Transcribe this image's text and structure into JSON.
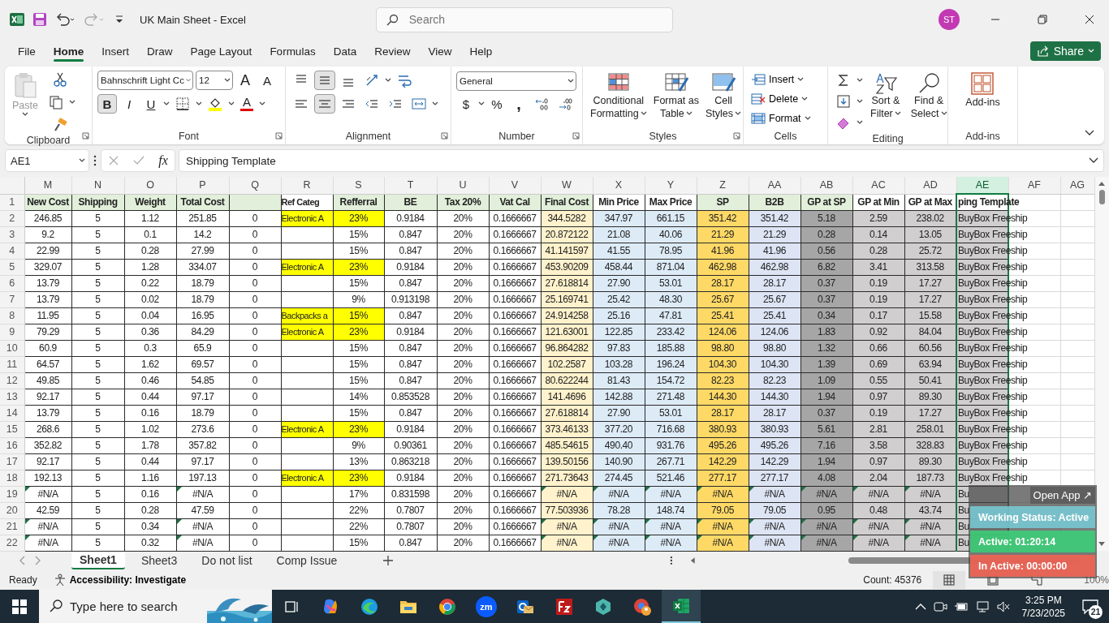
{
  "title_bar": {
    "title": "UK Main Sheet  -  Excel",
    "search_placeholder": "Search",
    "avatar": "ST"
  },
  "menu_tabs": [
    {
      "label": "File",
      "selected": false
    },
    {
      "label": "Home",
      "selected": true
    },
    {
      "label": "Insert",
      "selected": false
    },
    {
      "label": "Draw",
      "selected": false
    },
    {
      "label": "Page Layout",
      "selected": false
    },
    {
      "label": "Formulas",
      "selected": false
    },
    {
      "label": "Data",
      "selected": false
    },
    {
      "label": "Review",
      "selected": false
    },
    {
      "label": "View",
      "selected": false
    },
    {
      "label": "Help",
      "selected": false
    }
  ],
  "share_button": "Share",
  "ribbon": {
    "groups": [
      {
        "kind": "clipboard",
        "label": "Clipboard",
        "paste": "Paste"
      },
      {
        "kind": "font",
        "label": "Font",
        "font_name": "Bahnschrift Light Cc",
        "font_size": "12",
        "grow": "A",
        "shrink": "A",
        "font_color": "A",
        "styles": [
          {
            "kind": "bold",
            "label": "B",
            "on": true
          },
          {
            "kind": "italic",
            "label": "I",
            "on": false
          },
          {
            "kind": "underline",
            "label": "U",
            "on": false
          }
        ]
      },
      {
        "kind": "alignment",
        "label": "Alignment",
        "vertical": [
          {
            "kind": "top",
            "on": false
          },
          {
            "kind": "middle",
            "on": true
          },
          {
            "kind": "bottom",
            "on": false
          }
        ],
        "horizontal": [
          {
            "kind": "left",
            "on": false
          },
          {
            "kind": "center",
            "on": true
          },
          {
            "kind": "right",
            "on": false
          }
        ]
      },
      {
        "kind": "number",
        "label": "Number",
        "format": "General",
        "currency": "$",
        "percent": "%",
        "comma": ","
      },
      {
        "kind": "styles",
        "label": "Styles",
        "buttons": [
          {
            "line1": "Conditional",
            "line2": "Formatting"
          },
          {
            "line1": "Format as",
            "line2": "Table"
          },
          {
            "line1": "Cell",
            "line2": "Styles"
          }
        ]
      },
      {
        "kind": "cells",
        "label": "Cells",
        "buttons": [
          "Insert",
          "Delete",
          "Format"
        ]
      },
      {
        "kind": "editing",
        "label": "Editing",
        "buttons": [
          {
            "line1": "Sort &",
            "line2": "Filter"
          },
          {
            "line1": "Find &",
            "line2": "Select"
          }
        ]
      },
      {
        "kind": "addins",
        "label": "Add-ins",
        "button": "Add-ins"
      }
    ]
  },
  "formula_bar": {
    "name_box": "AE1",
    "fx": "fx",
    "formula": "Shipping Template"
  },
  "columns": [
    {
      "label": "M",
      "color": "#ffffff",
      "header_shaded": true,
      "error_check": true,
      "selected": false
    },
    {
      "label": "N",
      "color": "#ffffff",
      "header_shaded": true,
      "error_check": false,
      "selected": false
    },
    {
      "label": "O",
      "color": "#ffffff",
      "header_shaded": true,
      "error_check": false,
      "selected": false
    },
    {
      "label": "P",
      "color": "#ffffff",
      "header_shaded": true,
      "error_check": true,
      "selected": false
    },
    {
      "label": "Q",
      "color": "#ffffff",
      "header_shaded": true,
      "error_check": false,
      "selected": false
    },
    {
      "label": "R",
      "color": "#ffffff",
      "header_shaded": false,
      "error_check": false,
      "selected": false
    },
    {
      "label": "S",
      "color": "#ffffff",
      "header_shaded": true,
      "error_check": false,
      "selected": false
    },
    {
      "label": "T",
      "color": "#ffffff",
      "header_shaded": true,
      "error_check": false,
      "selected": false
    },
    {
      "label": "U",
      "color": "#ffffff",
      "header_shaded": true,
      "error_check": false,
      "selected": false
    },
    {
      "label": "V",
      "color": "#ffffff",
      "header_shaded": true,
      "error_check": false,
      "selected": false
    },
    {
      "label": "W",
      "color": "#fff2cc",
      "header_shaded": true,
      "error_check": true,
      "selected": false
    },
    {
      "label": "X",
      "color": "#ddebf7",
      "header_shaded": false,
      "error_check": true,
      "selected": false
    },
    {
      "label": "Y",
      "color": "#ddebf7",
      "header_shaded": false,
      "error_check": true,
      "selected": false
    },
    {
      "label": "Z",
      "color": "#ffd966",
      "header_shaded": true,
      "error_check": true,
      "selected": false
    },
    {
      "label": "AA",
      "color": "#dde4f4",
      "header_shaded": true,
      "error_check": true,
      "selected": false
    },
    {
      "label": "AB",
      "color": "#a6a6a6",
      "header_shaded": true,
      "error_check": true,
      "selected": false
    },
    {
      "label": "AC",
      "color": "#d0cece",
      "header_shaded": false,
      "error_check": true,
      "selected": false
    },
    {
      "label": "AD",
      "color": "#d0cece",
      "header_shaded": false,
      "error_check": true,
      "selected": false
    },
    {
      "label": "AE",
      "color": "#d0cece",
      "header_shaded": false,
      "error_check": false,
      "selected": true
    },
    {
      "label": "AF",
      "color": "#ffffff",
      "header_shaded": false,
      "error_check": false,
      "selected": false
    },
    {
      "label": "AG",
      "color": "#ffffff",
      "header_shaded": false,
      "error_check": false,
      "selected": false
    }
  ],
  "header_row": {
    "number": "1",
    "cells": [
      "New Cost",
      "Shipping",
      "Weight",
      "Total Cost",
      "",
      "Ref Categ",
      "Refferral",
      "BE",
      "Tax 20%",
      "Vat Cal",
      "Final Cost",
      "Min Price",
      "Max Price",
      "SP",
      "B2B",
      "GP at SP",
      "GP at Min",
      "GP at Max",
      "ping Template",
      "",
      ""
    ]
  },
  "rows": [
    {
      "number": "2",
      "highlight": true,
      "flagged": false,
      "cells": [
        "246.85",
        "5",
        "1.12",
        "251.85",
        "0",
        "Electronic A",
        "23%",
        "0.9184",
        "20%",
        "0.1666667",
        "344.5282",
        "347.97",
        "661.15",
        "351.42",
        "351.42",
        "5.18",
        "2.59",
        "238.02",
        "BuyBox Freeship",
        "",
        ""
      ]
    },
    {
      "number": "3",
      "highlight": false,
      "flagged": false,
      "cells": [
        "9.2",
        "5",
        "0.1",
        "14.2",
        "0",
        "",
        "15%",
        "0.847",
        "20%",
        "0.1666667",
        "20.872122",
        "21.08",
        "40.06",
        "21.29",
        "21.29",
        "0.28",
        "0.14",
        "13.05",
        "BuyBox Freeship",
        "",
        ""
      ]
    },
    {
      "number": "4",
      "highlight": false,
      "flagged": false,
      "cells": [
        "22.99",
        "5",
        "0.28",
        "27.99",
        "0",
        "",
        "15%",
        "0.847",
        "20%",
        "0.1666667",
        "41.141597",
        "41.55",
        "78.95",
        "41.96",
        "41.96",
        "0.56",
        "0.28",
        "25.72",
        "BuyBox Freeship",
        "",
        ""
      ]
    },
    {
      "number": "5",
      "highlight": true,
      "flagged": false,
      "cells": [
        "329.07",
        "5",
        "1.28",
        "334.07",
        "0",
        "Electronic A",
        "23%",
        "0.9184",
        "20%",
        "0.1666667",
        "453.90209",
        "458.44",
        "871.04",
        "462.98",
        "462.98",
        "6.82",
        "3.41",
        "313.58",
        "BuyBox Freeship",
        "",
        ""
      ]
    },
    {
      "number": "6",
      "highlight": false,
      "flagged": false,
      "cells": [
        "13.79",
        "5",
        "0.22",
        "18.79",
        "0",
        "",
        "15%",
        "0.847",
        "20%",
        "0.1666667",
        "27.618814",
        "27.90",
        "53.01",
        "28.17",
        "28.17",
        "0.37",
        "0.19",
        "17.27",
        "BuyBox Freeship",
        "",
        ""
      ]
    },
    {
      "number": "7",
      "highlight": false,
      "flagged": false,
      "cells": [
        "13.79",
        "5",
        "0.02",
        "18.79",
        "0",
        "",
        "9%",
        "0.913198",
        "20%",
        "0.1666667",
        "25.169741",
        "25.42",
        "48.30",
        "25.67",
        "25.67",
        "0.37",
        "0.19",
        "17.27",
        "BuyBox Freeship",
        "",
        ""
      ]
    },
    {
      "number": "8",
      "highlight": true,
      "flagged": false,
      "cells": [
        "11.95",
        "5",
        "0.04",
        "16.95",
        "0",
        "Backpacks a",
        "15%",
        "0.847",
        "20%",
        "0.1666667",
        "24.914258",
        "25.16",
        "47.81",
        "25.41",
        "25.41",
        "0.34",
        "0.17",
        "15.58",
        "BuyBox Freeship",
        "",
        ""
      ]
    },
    {
      "number": "9",
      "highlight": true,
      "flagged": false,
      "cells": [
        "79.29",
        "5",
        "0.36",
        "84.29",
        "0",
        "Electronic A",
        "23%",
        "0.9184",
        "20%",
        "0.1666667",
        "121.63001",
        "122.85",
        "233.42",
        "124.06",
        "124.06",
        "1.83",
        "0.92",
        "84.04",
        "BuyBox Freeship",
        "",
        ""
      ]
    },
    {
      "number": "10",
      "highlight": false,
      "flagged": false,
      "cells": [
        "60.9",
        "5",
        "0.3",
        "65.9",
        "0",
        "",
        "15%",
        "0.847",
        "20%",
        "0.1666667",
        "96.864282",
        "97.83",
        "185.88",
        "98.80",
        "98.80",
        "1.32",
        "0.66",
        "60.56",
        "BuyBox Freeship",
        "",
        ""
      ]
    },
    {
      "number": "11",
      "highlight": false,
      "flagged": false,
      "cells": [
        "64.57",
        "5",
        "1.62",
        "69.57",
        "0",
        "",
        "15%",
        "0.847",
        "20%",
        "0.1666667",
        "102.2587",
        "103.28",
        "196.24",
        "104.30",
        "104.30",
        "1.39",
        "0.69",
        "63.94",
        "BuyBox Freeship",
        "",
        ""
      ]
    },
    {
      "number": "12",
      "highlight": false,
      "flagged": false,
      "cells": [
        "49.85",
        "5",
        "0.46",
        "54.85",
        "0",
        "",
        "15%",
        "0.847",
        "20%",
        "0.1666667",
        "80.622244",
        "81.43",
        "154.72",
        "82.23",
        "82.23",
        "1.09",
        "0.55",
        "50.41",
        "BuyBox Freeship",
        "",
        ""
      ]
    },
    {
      "number": "13",
      "highlight": false,
      "flagged": false,
      "cells": [
        "92.17",
        "5",
        "0.44",
        "97.17",
        "0",
        "",
        "14%",
        "0.853528",
        "20%",
        "0.1666667",
        "141.4696",
        "142.88",
        "271.48",
        "144.30",
        "144.30",
        "1.94",
        "0.97",
        "89.30",
        "BuyBox Freeship",
        "",
        ""
      ]
    },
    {
      "number": "14",
      "highlight": false,
      "flagged": false,
      "cells": [
        "13.79",
        "5",
        "0.16",
        "18.79",
        "0",
        "",
        "15%",
        "0.847",
        "20%",
        "0.1666667",
        "27.618814",
        "27.90",
        "53.01",
        "28.17",
        "28.17",
        "0.37",
        "0.19",
        "17.27",
        "BuyBox Freeship",
        "",
        ""
      ]
    },
    {
      "number": "15",
      "highlight": true,
      "flagged": false,
      "cells": [
        "268.6",
        "5",
        "1.02",
        "273.6",
        "0",
        "Electronic A",
        "23%",
        "0.9184",
        "20%",
        "0.1666667",
        "373.46133",
        "377.20",
        "716.68",
        "380.93",
        "380.93",
        "5.61",
        "2.81",
        "258.01",
        "BuyBox Freeship",
        "",
        ""
      ]
    },
    {
      "number": "16",
      "highlight": false,
      "flagged": false,
      "cells": [
        "352.82",
        "5",
        "1.78",
        "357.82",
        "0",
        "",
        "9%",
        "0.90361",
        "20%",
        "0.1666667",
        "485.54615",
        "490.40",
        "931.76",
        "495.26",
        "495.26",
        "7.16",
        "3.58",
        "328.83",
        "BuyBox Freeship",
        "",
        ""
      ]
    },
    {
      "number": "17",
      "highlight": false,
      "flagged": false,
      "cells": [
        "92.17",
        "5",
        "0.44",
        "97.17",
        "0",
        "",
        "13%",
        "0.863218",
        "20%",
        "0.1666667",
        "139.50156",
        "140.90",
        "267.71",
        "142.29",
        "142.29",
        "1.94",
        "0.97",
        "89.30",
        "BuyBox Freeship",
        "",
        ""
      ]
    },
    {
      "number": "18",
      "highlight": true,
      "flagged": false,
      "cells": [
        "192.13",
        "5",
        "1.16",
        "197.13",
        "0",
        "Electronic A",
        "23%",
        "0.9184",
        "20%",
        "0.1666667",
        "271.73643",
        "274.45",
        "521.46",
        "277.17",
        "277.17",
        "4.08",
        "2.04",
        "187.73",
        "BuyBox Freeship",
        "",
        ""
      ]
    },
    {
      "number": "19",
      "highlight": false,
      "flagged": true,
      "cells": [
        "#N/A",
        "5",
        "0.16",
        "#N/A",
        "0",
        "",
        "17%",
        "0.831598",
        "20%",
        "0.1666667",
        "#N/A",
        "#N/A",
        "#N/A",
        "#N/A",
        "#N/A",
        "#N/A",
        "#N/A",
        "#N/A",
        "Bu",
        "",
        ""
      ]
    },
    {
      "number": "20",
      "highlight": false,
      "flagged": false,
      "cells": [
        "42.59",
        "5",
        "0.28",
        "47.59",
        "0",
        "",
        "22%",
        "0.7807",
        "20%",
        "0.1666667",
        "77.503936",
        "78.28",
        "148.74",
        "79.05",
        "79.05",
        "0.95",
        "0.48",
        "43.74",
        "Bu",
        "",
        ""
      ]
    },
    {
      "number": "21",
      "highlight": false,
      "flagged": true,
      "cells": [
        "#N/A",
        "5",
        "0.34",
        "#N/A",
        "0",
        "",
        "22%",
        "0.7807",
        "20%",
        "0.1666667",
        "#N/A",
        "#N/A",
        "#N/A",
        "#N/A",
        "#N/A",
        "#N/A",
        "#N/A",
        "#N/A",
        "Bu",
        "",
        ""
      ]
    },
    {
      "number": "22",
      "highlight": false,
      "flagged": true,
      "cells": [
        "#N/A",
        "5",
        "0.32",
        "#N/A",
        "0",
        "",
        "15%",
        "0.847",
        "20%",
        "0.1666667",
        "#N/A",
        "#N/A",
        "#N/A",
        "#N/A",
        "#N/A",
        "#N/A",
        "#N/A",
        "#N/A",
        "Bu",
        "",
        ""
      ]
    }
  ],
  "sheet_tabs": [
    {
      "label": "Sheet1",
      "selected": true
    },
    {
      "label": "Sheet3",
      "selected": false
    },
    {
      "label": "Do not list",
      "selected": false
    },
    {
      "label": "Comp Issue",
      "selected": false
    }
  ],
  "status_bar": {
    "ready": "Ready",
    "accessibility": "Accessibility: Investigate",
    "count": "Count: 45376",
    "zoom": "100%"
  },
  "tracker": {
    "open_app": "Open App ↗",
    "status": "Working Status: Active",
    "active": "Active: 01:20:14",
    "inactive": "In Active: 00:00:00"
  },
  "taskbar": {
    "search_placeholder": "Type here to search",
    "zoom_app": "zm",
    "time": "3:25 PM",
    "date": "7/23/2025",
    "notifications": "21"
  }
}
